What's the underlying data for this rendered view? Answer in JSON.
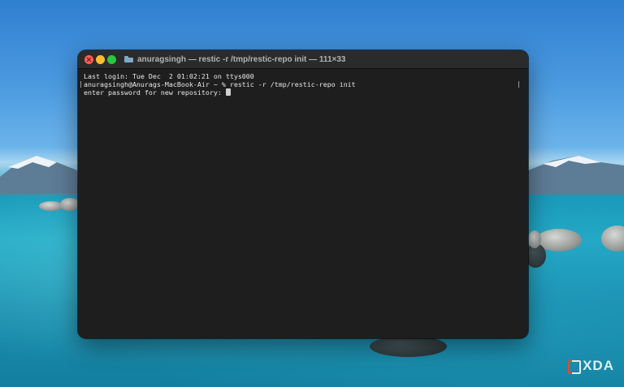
{
  "window": {
    "title": "anuragsingh — restic -r /tmp/restic-repo init — 111×33",
    "title_icon": "folder-icon"
  },
  "terminal": {
    "lines": [
      "Last login: Tue Dec  2 01:02:21 on ttys000",
      "anuragsingh@Anurags-MacBook-Air ~ % restic -r /tmp/restic-repo init",
      "enter password for new repository: "
    ]
  },
  "watermark": {
    "text": "XDA"
  },
  "colors": {
    "terminal_bg": "#1e1e1e",
    "titlebar_bg": "#2b2b2b",
    "close": "#fe5f57",
    "minimize": "#febc2e",
    "zoom": "#28c840",
    "text": "#e8e8e8"
  }
}
